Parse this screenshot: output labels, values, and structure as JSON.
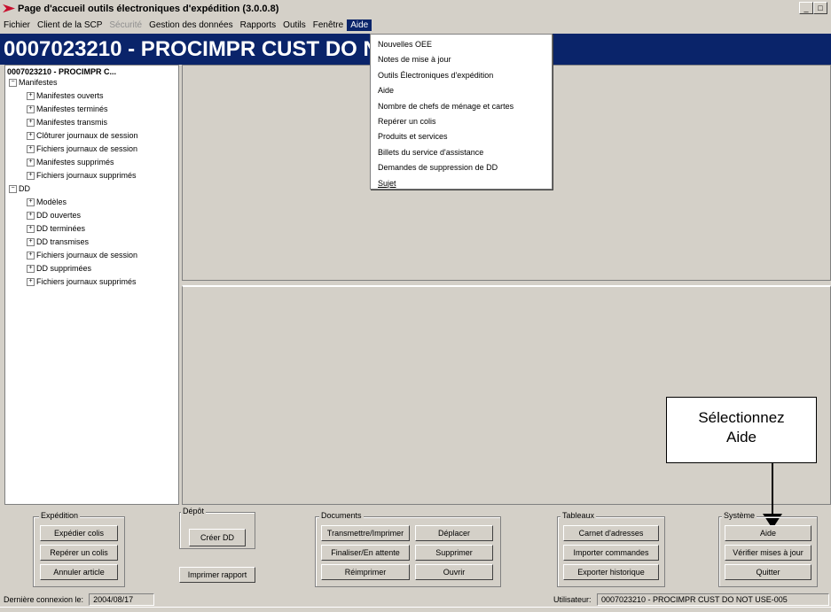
{
  "window": {
    "title": "Page d'accueil outils électroniques d'expédition (3.0.0.8)",
    "minimize": "_",
    "maximize": "□"
  },
  "menubar": {
    "items": [
      {
        "label": "Fichier",
        "state": "normal"
      },
      {
        "label": "Client de la SCP",
        "state": "normal"
      },
      {
        "label": "Sécurité",
        "state": "disabled"
      },
      {
        "label": "Gestion des données",
        "state": "normal"
      },
      {
        "label": "Rapports",
        "state": "normal"
      },
      {
        "label": "Outils",
        "state": "normal"
      },
      {
        "label": "Fenêtre",
        "state": "normal"
      },
      {
        "label": "Aide",
        "state": "active"
      }
    ]
  },
  "banner": {
    "text": "0007023210 - PROCIMPR CUST DO N"
  },
  "tree": {
    "root": "0007023210 - PROCIMPR C...",
    "nodes": [
      {
        "label": "Manifestes",
        "level": 0,
        "sign": "−"
      },
      {
        "label": "Manifestes ouverts",
        "level": 1,
        "sign": "+"
      },
      {
        "label": "Manifestes terminés",
        "level": 1,
        "sign": "+"
      },
      {
        "label": "Manifestes transmis",
        "level": 1,
        "sign": "+"
      },
      {
        "label": "Clôturer journaux de session",
        "level": 1,
        "sign": "+"
      },
      {
        "label": "Fichiers journaux de session",
        "level": 1,
        "sign": "+"
      },
      {
        "label": "Manifestes supprimés",
        "level": 1,
        "sign": "+"
      },
      {
        "label": "Fichiers journaux supprimés",
        "level": 1,
        "sign": "+"
      },
      {
        "label": "DD",
        "level": 0,
        "sign": "−"
      },
      {
        "label": "Modèles",
        "level": 1,
        "sign": "+"
      },
      {
        "label": "DD ouvertes",
        "level": 1,
        "sign": "+"
      },
      {
        "label": "DD terminées",
        "level": 1,
        "sign": "+"
      },
      {
        "label": "DD transmises",
        "level": 1,
        "sign": "+"
      },
      {
        "label": "Fichiers journaux de session",
        "level": 1,
        "sign": "+"
      },
      {
        "label": "DD supprimées",
        "level": 1,
        "sign": "+"
      },
      {
        "label": "Fichiers journaux supprimés",
        "level": 1,
        "sign": "+"
      }
    ]
  },
  "help_menu": {
    "items": [
      "Nouvelles OEE",
      "Notes de mise à jour",
      "Outils Électroniques d'expédition",
      "Aide",
      "Nombre de chefs de ménage et cartes",
      "Repérer un colis",
      "Produits et services",
      "Billets du service d'assistance",
      "Demandes de suppression de DD",
      "Sujet"
    ]
  },
  "callout": {
    "line1": "Sélectionnez",
    "line2": "Aide"
  },
  "groups": {
    "expedition": {
      "label": "Expédition",
      "buttons": [
        "Expédier colis",
        "Repérer un colis",
        "Annuler article"
      ]
    },
    "depot": {
      "label": "Dépôt",
      "create": "Créer DD",
      "print_report": "Imprimer rapport"
    },
    "documents": {
      "label": "Documents",
      "buttons": [
        "Transmettre/Imprimer",
        "Déplacer",
        "Finaliser/En attente",
        "Supprimer",
        "Réimprimer",
        "Ouvrir"
      ]
    },
    "tableaux": {
      "label": "Tableaux",
      "buttons": [
        "Carnet d'adresses",
        "Importer commandes",
        "Exporter historique"
      ]
    },
    "systeme": {
      "label": "Système",
      "buttons": [
        "Aide",
        "Vérifier mises à jour",
        "Quitter"
      ]
    }
  },
  "status": {
    "last_login_label": "Dernière connexion le:",
    "last_login_value": "2004/08/17",
    "user_label": "Utilisateur:",
    "user_value": "0007023210 - PROCIMPR CUST DO NOT USE-005"
  }
}
